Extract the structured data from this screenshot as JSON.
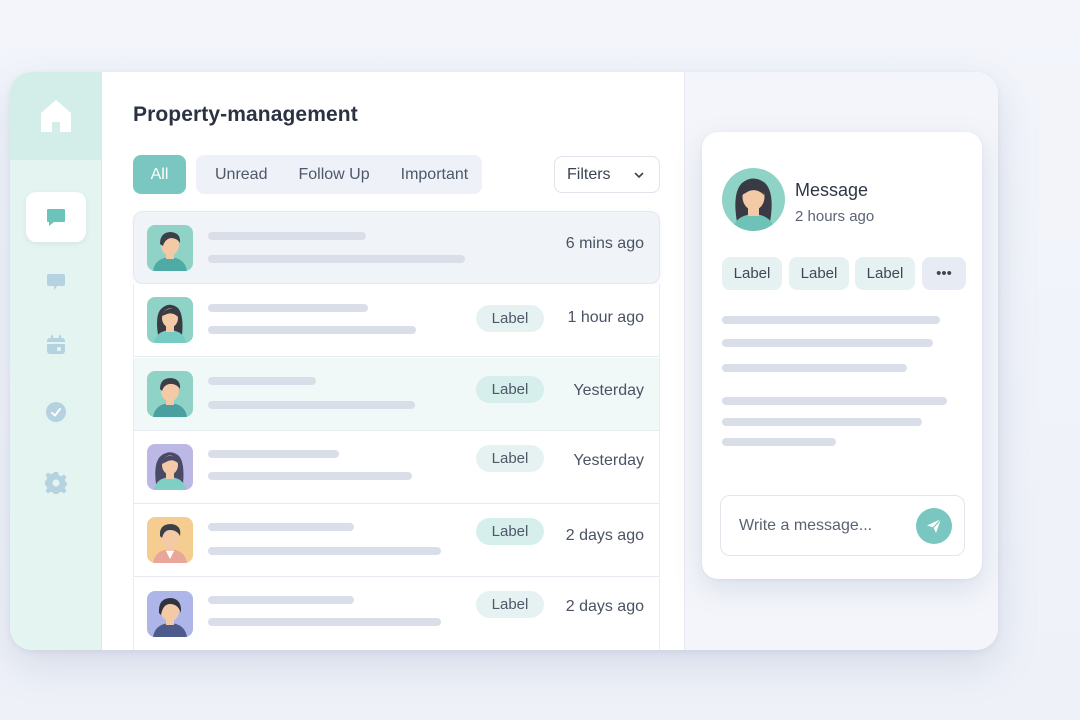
{
  "app": {
    "title": "Property-management",
    "accent": "#79c7c0"
  },
  "sidebar": {
    "logo": "home-icon",
    "items": [
      {
        "icon": "chat-icon",
        "active": true
      },
      {
        "icon": "message-icon",
        "active": false
      },
      {
        "icon": "calendar-icon",
        "active": false
      },
      {
        "icon": "check-circle-icon",
        "active": false
      },
      {
        "icon": "gear-icon",
        "active": false
      }
    ]
  },
  "tabs": {
    "all": "All",
    "unread": "Unread",
    "follow_up": "Follow Up",
    "important": "Important"
  },
  "filters": {
    "label": "Filters",
    "icon": "chevron-down-icon"
  },
  "conversations": [
    {
      "time": "6 mins ago",
      "label": ""
    },
    {
      "time": "1 hour ago",
      "label": "Label"
    },
    {
      "time": "Yesterday",
      "label": "Label"
    },
    {
      "time": "Yesterday",
      "label": "Label"
    },
    {
      "time": "2 days ago",
      "label": "Label"
    },
    {
      "time": "2 days ago",
      "label": "Label"
    }
  ],
  "detail": {
    "title": "Message",
    "subtitle": "2 hours ago",
    "chips": [
      "Label",
      "Label",
      "Label"
    ],
    "more": "•••",
    "composer_placeholder": "Write a message...",
    "send_icon": "send-icon"
  }
}
